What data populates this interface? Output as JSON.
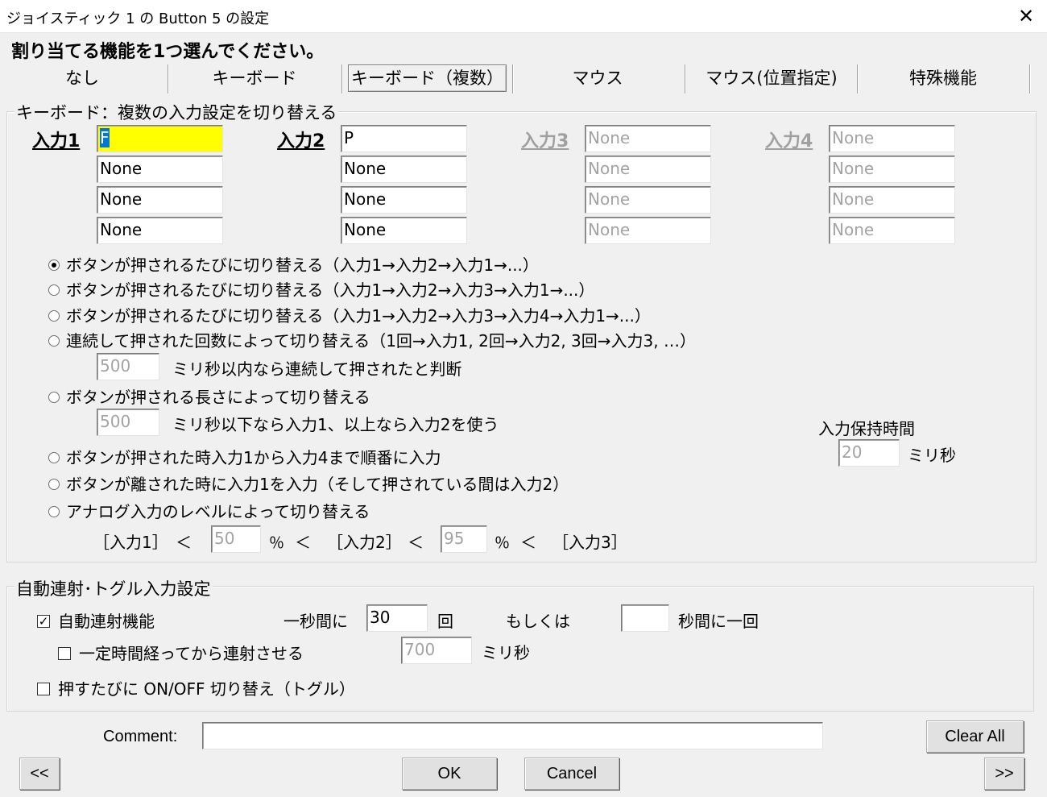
{
  "window": {
    "title": "ジョイスティック 1 の Button 5 の設定"
  },
  "instruction": "割り当てる機能を1つ選んでください。",
  "tabs": [
    {
      "label": "なし"
    },
    {
      "label": "キーボード"
    },
    {
      "label": "キーボード（複数）"
    },
    {
      "label": "マウス"
    },
    {
      "label": "マウス(位置指定)"
    },
    {
      "label": "特殊機能"
    }
  ],
  "keyboard_group": {
    "title": "キーボード：複数の入力設定を切り替える",
    "inputs": [
      {
        "label": "入力1",
        "values": [
          "F",
          "None",
          "None",
          "None"
        ]
      },
      {
        "label": "入力2",
        "values": [
          "P",
          "None",
          "None",
          "None"
        ]
      },
      {
        "label": "入力3",
        "values": [
          "None",
          "None",
          "None",
          "None"
        ]
      },
      {
        "label": "入力4",
        "values": [
          "None",
          "None",
          "None",
          "None"
        ]
      }
    ],
    "options": [
      "ボタンが押されるたびに切り替える（入力1→入力2→入力1→...）",
      "ボタンが押されるたびに切り替える（入力1→入力2→入力3→入力1→...）",
      "ボタンが押されるたびに切り替える（入力1→入力2→入力3→入力4→入力1→...）",
      "連続して押された回数によって切り替える（1回→入力1, 2回→入力2, 3回→入力3, …）",
      "ボタンが押される長さによって切り替える",
      "ボタンが押された時入力1から入力4まで順番に入力",
      "ボタンが離された時に入力1を入力（そして押されている間は入力2）",
      "アナログ入力のレベルによって切り替える"
    ],
    "selected_option": 0,
    "consecutive_ms": "500",
    "consecutive_label": "ミリ秒以内なら連続して押されたと判断",
    "length_ms": "500",
    "length_label": "ミリ秒以下なら入力1、以上なら入力2を使う",
    "hold_title": "入力保持時間",
    "hold_value": "20",
    "hold_unit": "ミリ秒",
    "analog": {
      "in1": "［入力1］",
      "lt": "＜",
      "th1": "50",
      "pct": "％",
      "in2": "［入力2］",
      "th2": "95",
      "in3": "［入力3］"
    }
  },
  "auto_group": {
    "title": "自動連射･トグル入力設定",
    "auto_fire_label": "自動連射機能",
    "auto_fire_checked": "✓",
    "per_second_label": "一秒間に",
    "per_second_value": "30",
    "times_label": "回",
    "or_label": "もしくは",
    "seconds_value": "",
    "seconds_label": "秒間に一回",
    "delay_label": "一定時間経ってから連射させる",
    "delay_value": "700",
    "delay_unit": "ミリ秒",
    "toggle_label": "押すたびに ON/OFF 切り替え（トグル）"
  },
  "comment": {
    "label": "Comment:",
    "value": ""
  },
  "buttons": {
    "clear_all": "Clear All",
    "prev": "<<",
    "ok": "OK",
    "cancel": "Cancel",
    "next": ">>"
  },
  "icons": {
    "close": "close-icon"
  }
}
